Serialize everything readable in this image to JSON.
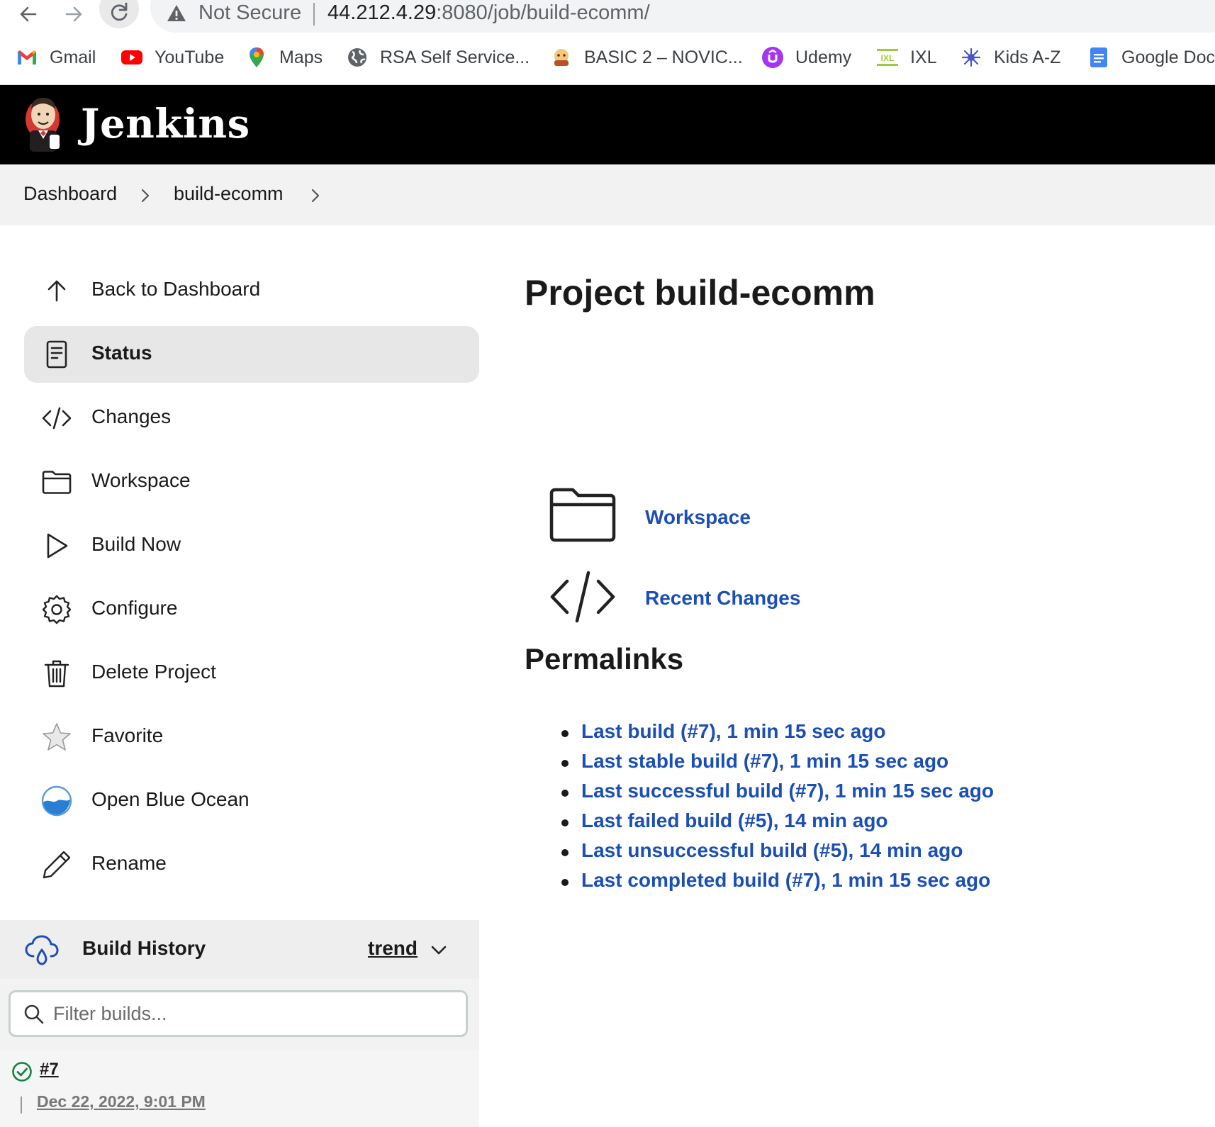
{
  "browser": {
    "security_label": "Not Secure",
    "url_host": "44.212.4.29",
    "url_rest": ":8080/job/build-ecomm/",
    "bookmarks": [
      {
        "label": "Gmail",
        "icon": "gmail-icon"
      },
      {
        "label": "YouTube",
        "icon": "youtube-icon"
      },
      {
        "label": "Maps",
        "icon": "maps-icon"
      },
      {
        "label": "RSA Self Service...",
        "icon": "globe-icon"
      },
      {
        "label": "BASIC 2 – NOVIC...",
        "icon": "basic-novice-icon"
      },
      {
        "label": "Udemy",
        "icon": "udemy-icon"
      },
      {
        "label": "IXL",
        "icon": "ixl-icon"
      },
      {
        "label": "Kids A-Z",
        "icon": "kids-az-icon"
      },
      {
        "label": "Google Doc",
        "icon": "google-docs-icon"
      }
    ]
  },
  "header": {
    "title": "Jenkins"
  },
  "breadcrumb": {
    "items": [
      "Dashboard",
      "build-ecomm"
    ]
  },
  "sidebar": {
    "tasks": [
      {
        "label": "Back to Dashboard",
        "icon": "arrow-up-icon"
      },
      {
        "label": "Status",
        "icon": "document-icon",
        "active": true
      },
      {
        "label": "Changes",
        "icon": "code-icon"
      },
      {
        "label": "Workspace",
        "icon": "folder-icon"
      },
      {
        "label": "Build Now",
        "icon": "play-icon"
      },
      {
        "label": "Configure",
        "icon": "gear-icon"
      },
      {
        "label": "Delete Project",
        "icon": "trash-icon"
      },
      {
        "label": "Favorite",
        "icon": "star-icon"
      },
      {
        "label": "Open Blue Ocean",
        "icon": "blue-ocean-icon"
      },
      {
        "label": "Rename",
        "icon": "pencil-icon"
      }
    ]
  },
  "build_history": {
    "title": "Build History",
    "trend_label": "trend",
    "filter_placeholder": "Filter builds...",
    "builds": [
      {
        "number": "#7",
        "date": "Dec 22, 2022, 9:01 PM",
        "status": "success"
      }
    ]
  },
  "main": {
    "title": "Project build-ecomm",
    "links": [
      {
        "label": "Workspace",
        "icon": "folder-icon"
      },
      {
        "label": "Recent Changes",
        "icon": "code-icon"
      }
    ],
    "permalinks_title": "Permalinks",
    "permalinks": [
      "Last build (#7), 1 min 15 sec ago",
      "Last stable build (#7), 1 min 15 sec ago",
      "Last successful build (#7), 1 min 15 sec ago",
      "Last failed build (#5), 14 min ago",
      "Last unsuccessful build (#5), 14 min ago",
      "Last completed build (#7), 1 min 15 sec ago"
    ]
  },
  "colors": {
    "link": "#1b4fb5",
    "header_bg": "#000000",
    "success": "#138347"
  }
}
